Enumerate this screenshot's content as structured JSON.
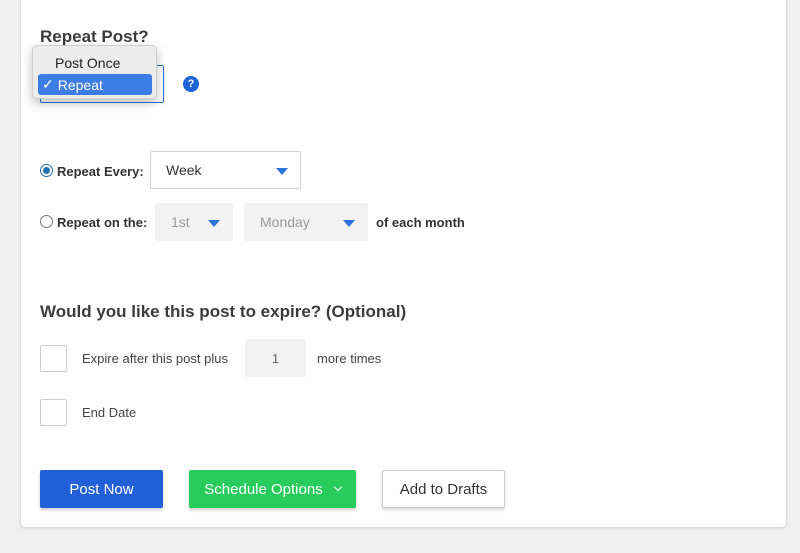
{
  "repeat_section": {
    "heading": "Repeat Post?",
    "dropdown": {
      "options": [
        "Post Once",
        "Repeat"
      ],
      "selected": "Repeat",
      "checkmark": "✓"
    },
    "help_icon_text": "?"
  },
  "repeat_every": {
    "label": "Repeat Every:",
    "value": "Week",
    "checked": true
  },
  "repeat_on": {
    "label": "Repeat on the:",
    "ordinal_value": "1st",
    "day_value": "Monday",
    "suffix": "of each month",
    "checked": false
  },
  "expire_section": {
    "heading": "Would you like this post to expire? (Optional)",
    "expire_after_label": "Expire after this post plus",
    "expire_count": "1",
    "more_times_label": "more times",
    "end_date_label": "End Date"
  },
  "actions": {
    "post_now": "Post Now",
    "schedule_options": "Schedule Options",
    "add_to_drafts": "Add to Drafts"
  },
  "colors": {
    "primary": "#2160d8",
    "green": "#28cc5c",
    "selected_item": "#3d7be5",
    "caret": "#2b73d9"
  },
  "icons": [
    "help-icon",
    "chevron-down-icon",
    "dropdown-caret-icon",
    "checkmark-icon"
  ]
}
